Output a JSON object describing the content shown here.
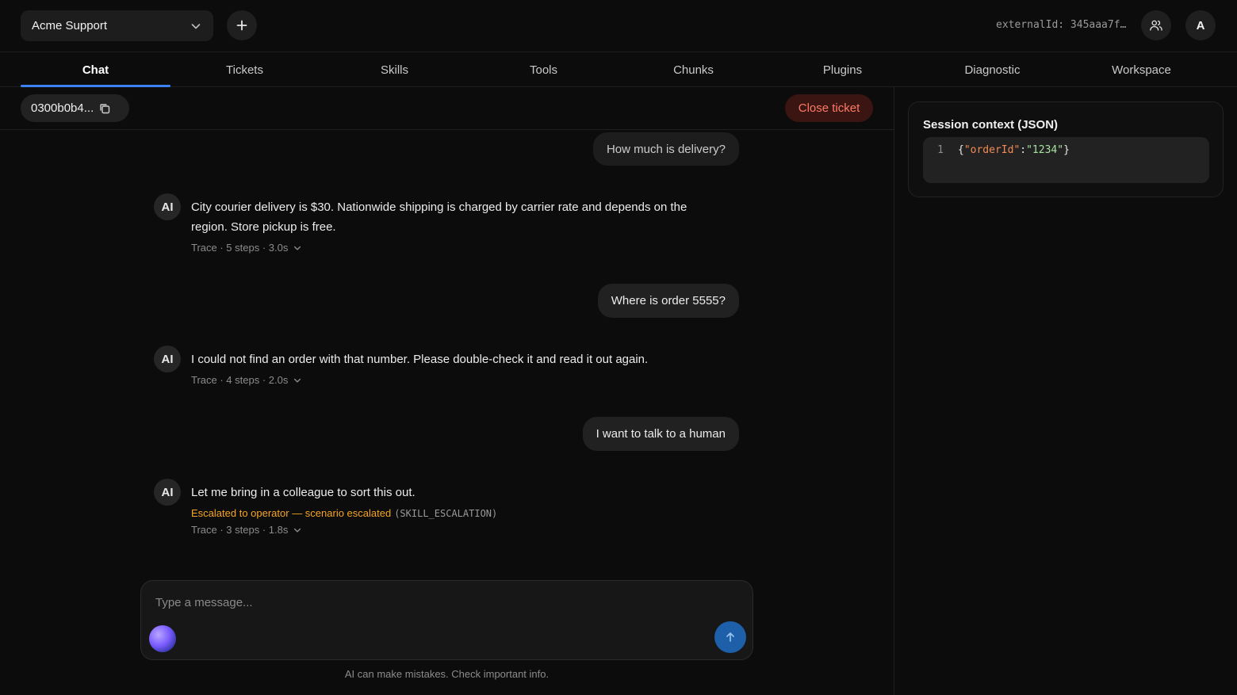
{
  "topbar": {
    "workspace": "Acme Support",
    "external_id": "externalId: 345aaa7f…",
    "avatar_letter": "A"
  },
  "tabs": [
    {
      "label": "Chat",
      "active": true
    },
    {
      "label": "Tickets"
    },
    {
      "label": "Skills"
    },
    {
      "label": "Tools"
    },
    {
      "label": "Chunks"
    },
    {
      "label": "Plugins"
    },
    {
      "label": "Diagnostic"
    },
    {
      "label": "Workspace"
    }
  ],
  "ticket": {
    "id": "0300b0b4...",
    "close_label": "Close ticket"
  },
  "messages": {
    "user_1": "How much is delivery?",
    "ai_1": {
      "avatar": "AI",
      "text": "City courier delivery is $30. Nationwide shipping is charged by carrier rate and depends on the region. Store pickup is free.",
      "trace": "Trace · 5 steps · 3.0s"
    },
    "user_2": "Where is order 5555?",
    "ai_2": {
      "avatar": "AI",
      "text": "I could not find an order with that number. Please double-check it and read it out again.",
      "trace": "Trace · 4 steps · 2.0s"
    },
    "user_3": "I want to talk to a human",
    "ai_3": {
      "avatar": "AI",
      "text": "Let me bring in a colleague to sort this out.",
      "escalation": "Escalated to operator — scenario escalated",
      "escalation_code": "(SKILL_ESCALATION)",
      "trace": "Trace · 3 steps · 1.8s"
    }
  },
  "composer": {
    "placeholder": "Type a message...",
    "disclaimer": "AI can make mistakes. Check important info."
  },
  "session_context": {
    "title": "Session context (JSON)",
    "line_number": "1",
    "open_brace": "{",
    "key": "\"orderId\"",
    "colon": ":",
    "value": "\"1234\"",
    "close_brace": "}"
  },
  "colors": {
    "accent": "#3b82f6",
    "danger": "#ff7a66",
    "warning": "#f5a524",
    "send": "#1d5fa8"
  }
}
